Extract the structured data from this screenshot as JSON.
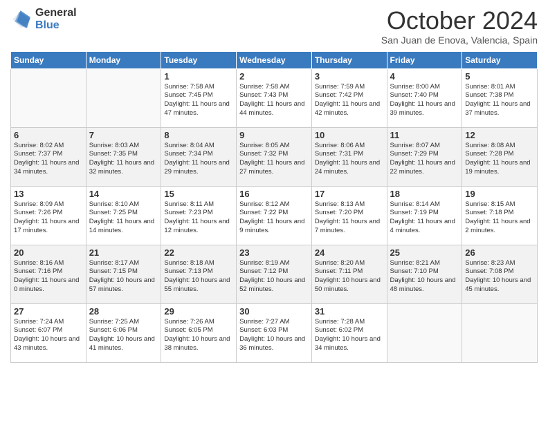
{
  "logo": {
    "general": "General",
    "blue": "Blue"
  },
  "title": "October 2024",
  "subtitle": "San Juan de Enova, Valencia, Spain",
  "days": [
    "Sunday",
    "Monday",
    "Tuesday",
    "Wednesday",
    "Thursday",
    "Friday",
    "Saturday"
  ],
  "weeks": [
    [
      {
        "day": "",
        "content": ""
      },
      {
        "day": "",
        "content": ""
      },
      {
        "day": "1",
        "content": "Sunrise: 7:58 AM\nSunset: 7:45 PM\nDaylight: 11 hours and 47 minutes."
      },
      {
        "day": "2",
        "content": "Sunrise: 7:58 AM\nSunset: 7:43 PM\nDaylight: 11 hours and 44 minutes."
      },
      {
        "day": "3",
        "content": "Sunrise: 7:59 AM\nSunset: 7:42 PM\nDaylight: 11 hours and 42 minutes."
      },
      {
        "day": "4",
        "content": "Sunrise: 8:00 AM\nSunset: 7:40 PM\nDaylight: 11 hours and 39 minutes."
      },
      {
        "day": "5",
        "content": "Sunrise: 8:01 AM\nSunset: 7:38 PM\nDaylight: 11 hours and 37 minutes."
      }
    ],
    [
      {
        "day": "6",
        "content": "Sunrise: 8:02 AM\nSunset: 7:37 PM\nDaylight: 11 hours and 34 minutes."
      },
      {
        "day": "7",
        "content": "Sunrise: 8:03 AM\nSunset: 7:35 PM\nDaylight: 11 hours and 32 minutes."
      },
      {
        "day": "8",
        "content": "Sunrise: 8:04 AM\nSunset: 7:34 PM\nDaylight: 11 hours and 29 minutes."
      },
      {
        "day": "9",
        "content": "Sunrise: 8:05 AM\nSunset: 7:32 PM\nDaylight: 11 hours and 27 minutes."
      },
      {
        "day": "10",
        "content": "Sunrise: 8:06 AM\nSunset: 7:31 PM\nDaylight: 11 hours and 24 minutes."
      },
      {
        "day": "11",
        "content": "Sunrise: 8:07 AM\nSunset: 7:29 PM\nDaylight: 11 hours and 22 minutes."
      },
      {
        "day": "12",
        "content": "Sunrise: 8:08 AM\nSunset: 7:28 PM\nDaylight: 11 hours and 19 minutes."
      }
    ],
    [
      {
        "day": "13",
        "content": "Sunrise: 8:09 AM\nSunset: 7:26 PM\nDaylight: 11 hours and 17 minutes."
      },
      {
        "day": "14",
        "content": "Sunrise: 8:10 AM\nSunset: 7:25 PM\nDaylight: 11 hours and 14 minutes."
      },
      {
        "day": "15",
        "content": "Sunrise: 8:11 AM\nSunset: 7:23 PM\nDaylight: 11 hours and 12 minutes."
      },
      {
        "day": "16",
        "content": "Sunrise: 8:12 AM\nSunset: 7:22 PM\nDaylight: 11 hours and 9 minutes."
      },
      {
        "day": "17",
        "content": "Sunrise: 8:13 AM\nSunset: 7:20 PM\nDaylight: 11 hours and 7 minutes."
      },
      {
        "day": "18",
        "content": "Sunrise: 8:14 AM\nSunset: 7:19 PM\nDaylight: 11 hours and 4 minutes."
      },
      {
        "day": "19",
        "content": "Sunrise: 8:15 AM\nSunset: 7:18 PM\nDaylight: 11 hours and 2 minutes."
      }
    ],
    [
      {
        "day": "20",
        "content": "Sunrise: 8:16 AM\nSunset: 7:16 PM\nDaylight: 11 hours and 0 minutes."
      },
      {
        "day": "21",
        "content": "Sunrise: 8:17 AM\nSunset: 7:15 PM\nDaylight: 10 hours and 57 minutes."
      },
      {
        "day": "22",
        "content": "Sunrise: 8:18 AM\nSunset: 7:13 PM\nDaylight: 10 hours and 55 minutes."
      },
      {
        "day": "23",
        "content": "Sunrise: 8:19 AM\nSunset: 7:12 PM\nDaylight: 10 hours and 52 minutes."
      },
      {
        "day": "24",
        "content": "Sunrise: 8:20 AM\nSunset: 7:11 PM\nDaylight: 10 hours and 50 minutes."
      },
      {
        "day": "25",
        "content": "Sunrise: 8:21 AM\nSunset: 7:10 PM\nDaylight: 10 hours and 48 minutes."
      },
      {
        "day": "26",
        "content": "Sunrise: 8:23 AM\nSunset: 7:08 PM\nDaylight: 10 hours and 45 minutes."
      }
    ],
    [
      {
        "day": "27",
        "content": "Sunrise: 7:24 AM\nSunset: 6:07 PM\nDaylight: 10 hours and 43 minutes."
      },
      {
        "day": "28",
        "content": "Sunrise: 7:25 AM\nSunset: 6:06 PM\nDaylight: 10 hours and 41 minutes."
      },
      {
        "day": "29",
        "content": "Sunrise: 7:26 AM\nSunset: 6:05 PM\nDaylight: 10 hours and 38 minutes."
      },
      {
        "day": "30",
        "content": "Sunrise: 7:27 AM\nSunset: 6:03 PM\nDaylight: 10 hours and 36 minutes."
      },
      {
        "day": "31",
        "content": "Sunrise: 7:28 AM\nSunset: 6:02 PM\nDaylight: 10 hours and 34 minutes."
      },
      {
        "day": "",
        "content": ""
      },
      {
        "day": "",
        "content": ""
      }
    ]
  ]
}
